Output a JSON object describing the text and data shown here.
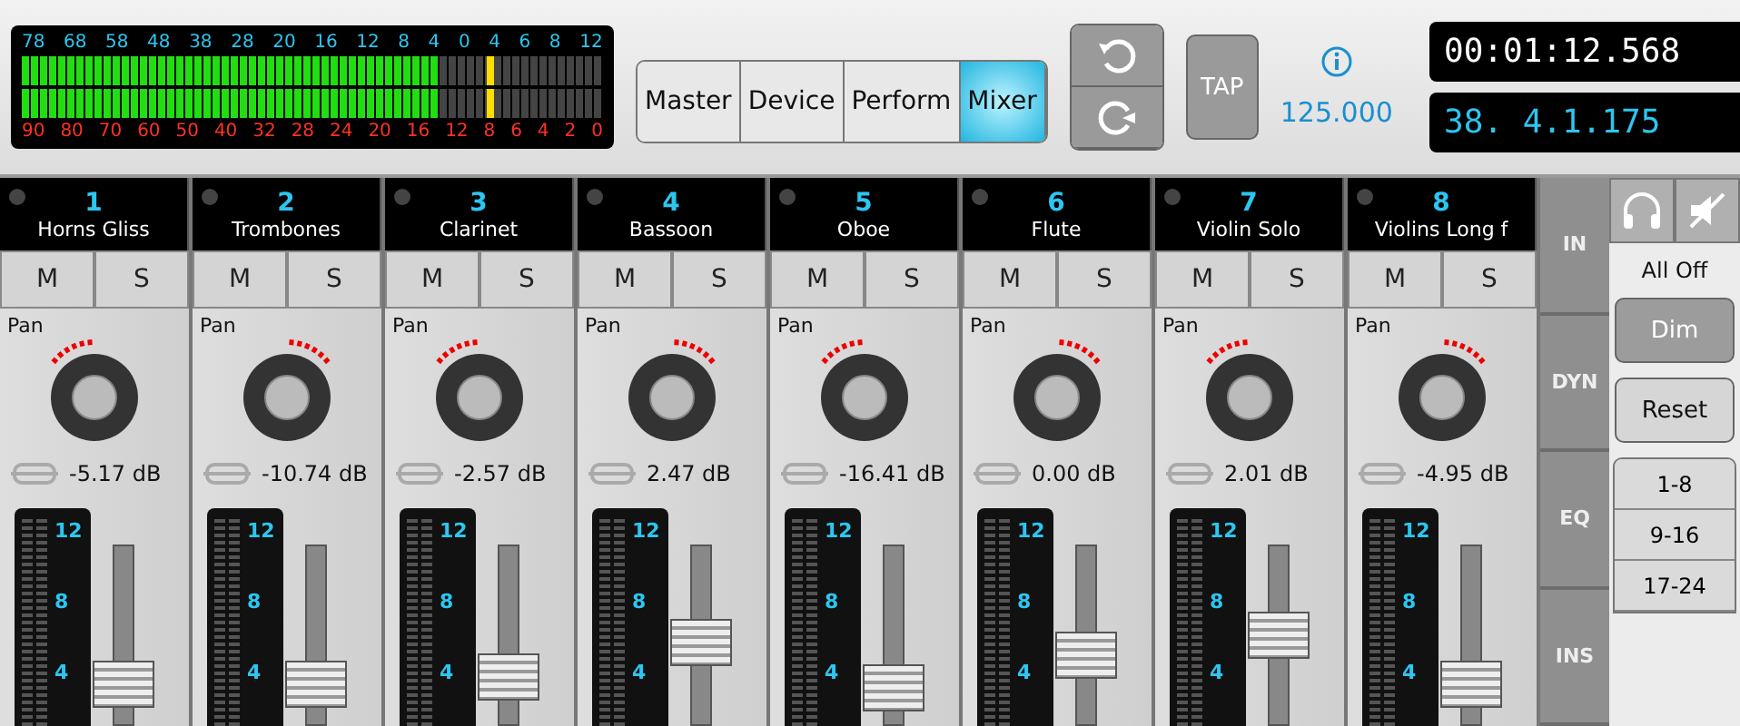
{
  "meter": {
    "top_scale": [
      "78",
      "68",
      "58",
      "48",
      "38",
      "28",
      "20",
      "16",
      "12",
      "8",
      "4",
      "0",
      "4",
      "6",
      "8",
      "12"
    ],
    "bottom_scale": [
      "90",
      "80",
      "70",
      "60",
      "50",
      "40",
      "32",
      "28",
      "24",
      "20",
      "16",
      "12",
      "8",
      "6",
      "4",
      "2",
      "0"
    ],
    "level": 0.72
  },
  "tabs": [
    {
      "label": "Master",
      "selected": false
    },
    {
      "label": "Device",
      "selected": false
    },
    {
      "label": "Perform",
      "selected": false
    },
    {
      "label": "Mixer",
      "selected": true
    }
  ],
  "tap": {
    "label": "TAP"
  },
  "tempo": "125.000",
  "time": "00:01:12.568",
  "position": "38. 4.1.175",
  "channels": [
    {
      "number": "1",
      "name": "Horns Gliss",
      "mute": "M",
      "solo": "S",
      "pan_label": "Pan",
      "gain": "-5.17 dB",
      "scale": [
        "12",
        "8",
        "4"
      ],
      "level": 0.12
    },
    {
      "number": "2",
      "name": "Trombones",
      "mute": "M",
      "solo": "S",
      "pan_label": "Pan",
      "gain": "-10.74 dB",
      "scale": [
        "12",
        "8",
        "4"
      ],
      "level": 0.12
    },
    {
      "number": "3",
      "name": "Clarinet",
      "mute": "M",
      "solo": "S",
      "pan_label": "Pan",
      "gain": "-2.57 dB",
      "scale": [
        "12",
        "8",
        "4"
      ],
      "level": 0.18
    },
    {
      "number": "4",
      "name": "Bassoon",
      "mute": "M",
      "solo": "S",
      "pan_label": "Pan",
      "gain": "2.47 dB",
      "scale": [
        "12",
        "8",
        "4"
      ],
      "level": 0.45
    },
    {
      "number": "5",
      "name": "Oboe",
      "mute": "M",
      "solo": "S",
      "pan_label": "Pan",
      "gain": "-16.41 dB",
      "scale": [
        "12",
        "8",
        "4"
      ],
      "level": 0.1
    },
    {
      "number": "6",
      "name": "Flute",
      "mute": "M",
      "solo": "S",
      "pan_label": "Pan",
      "gain": "0.00 dB",
      "scale": [
        "12",
        "8",
        "4"
      ],
      "level": 0.35
    },
    {
      "number": "7",
      "name": "Violin Solo",
      "mute": "M",
      "solo": "S",
      "pan_label": "Pan",
      "gain": "2.01 dB",
      "scale": [
        "12",
        "8",
        "4"
      ],
      "level": 0.5
    },
    {
      "number": "8",
      "name": "Violins Long f",
      "mute": "M",
      "solo": "S",
      "pan_label": "Pan",
      "gain": "-4.95 dB",
      "scale": [
        "12",
        "8",
        "4"
      ],
      "level": 0.12
    }
  ],
  "sections": [
    "IN",
    "DYN",
    "EQ",
    "INS"
  ],
  "monitor": {
    "all_off": "All Off",
    "dim": "Dim",
    "reset": "Reset",
    "banks": [
      "1-8",
      "9-16",
      "17-24"
    ]
  }
}
